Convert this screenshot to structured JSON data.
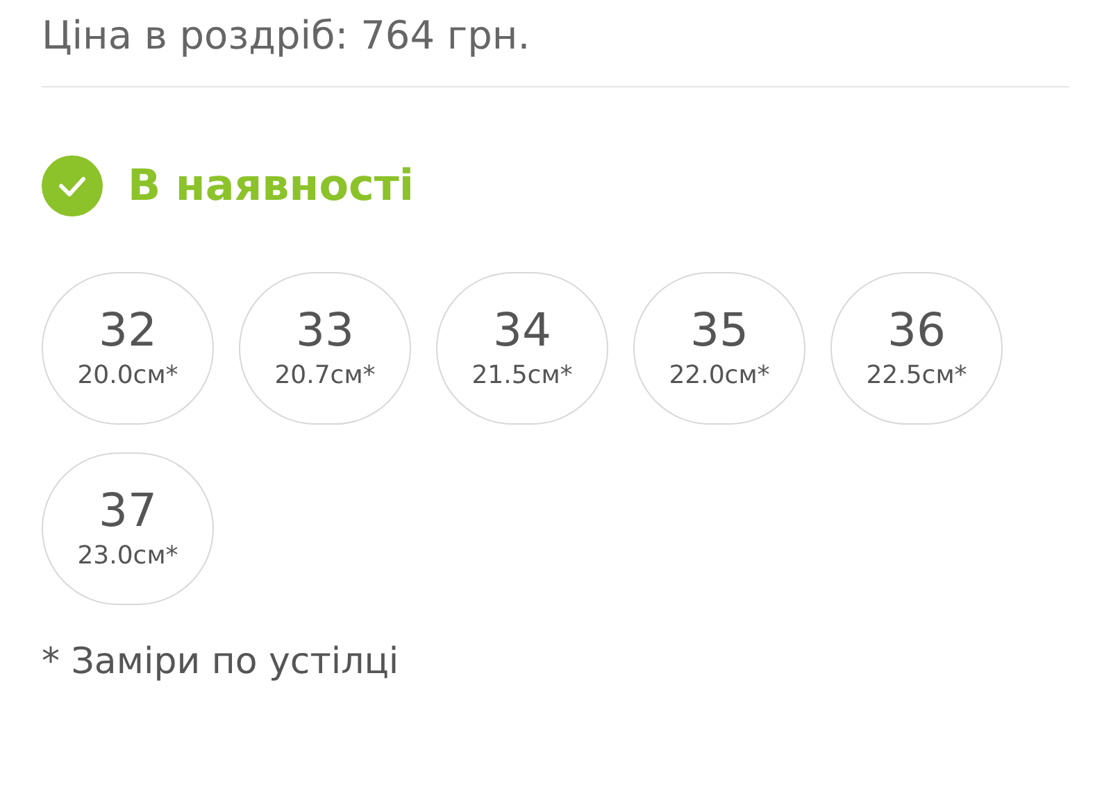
{
  "price": {
    "text": "Ціна в роздріб: 764 грн."
  },
  "availability": {
    "label": "В наявності",
    "in_stock": true
  },
  "sizes": [
    {
      "size": "32",
      "length": "20.0см*"
    },
    {
      "size": "33",
      "length": "20.7см*"
    },
    {
      "size": "34",
      "length": "21.5см*"
    },
    {
      "size": "35",
      "length": "22.0см*"
    },
    {
      "size": "36",
      "length": "22.5см*"
    },
    {
      "size": "37",
      "length": "23.0см*"
    }
  ],
  "footnote": "* Заміри по устілці"
}
